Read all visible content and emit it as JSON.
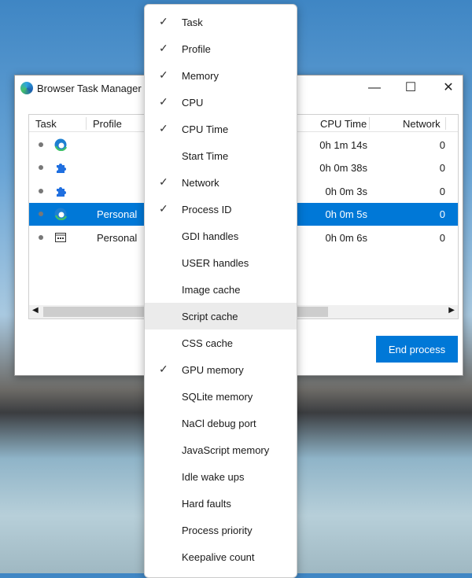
{
  "window": {
    "title": "Browser Task Manager",
    "minimize": "—",
    "maximize": "☐",
    "close": "✕"
  },
  "table": {
    "headers": {
      "task": "Task",
      "profile": "Profile",
      "cpu_time": "CPU Time",
      "network": "Network"
    },
    "rows": [
      {
        "icon": "edge-beta-icon",
        "profile": "",
        "cpu_time": "0h 1m 14s",
        "network": "0",
        "selected": false
      },
      {
        "icon": "extension-icon",
        "profile": "",
        "cpu_time": "0h 0m 38s",
        "network": "0",
        "selected": false
      },
      {
        "icon": "extension-icon",
        "profile": "",
        "cpu_time": "0h 0m 3s",
        "network": "0",
        "selected": false
      },
      {
        "icon": "edge-icon",
        "profile": "Personal",
        "cpu_time": "0h 0m 5s",
        "network": "0",
        "selected": true
      },
      {
        "icon": "utility-process-icon",
        "profile": "Personal",
        "cpu_time": "0h 0m 6s",
        "network": "0",
        "selected": false
      }
    ]
  },
  "end_process": "End process",
  "menu": {
    "check": "✓",
    "items": [
      {
        "label": "Task",
        "checked": true
      },
      {
        "label": "Profile",
        "checked": true
      },
      {
        "label": "Memory",
        "checked": true
      },
      {
        "label": "CPU",
        "checked": true
      },
      {
        "label": "CPU Time",
        "checked": true
      },
      {
        "label": "Start Time",
        "checked": false
      },
      {
        "label": "Network",
        "checked": true
      },
      {
        "label": "Process ID",
        "checked": true
      },
      {
        "label": "GDI handles",
        "checked": false
      },
      {
        "label": "USER handles",
        "checked": false
      },
      {
        "label": "Image cache",
        "checked": false
      },
      {
        "label": "Script cache",
        "checked": false,
        "hover": true
      },
      {
        "label": "CSS cache",
        "checked": false
      },
      {
        "label": "GPU memory",
        "checked": true
      },
      {
        "label": "SQLite memory",
        "checked": false
      },
      {
        "label": "NaCl debug port",
        "checked": false
      },
      {
        "label": "JavaScript memory",
        "checked": false
      },
      {
        "label": "Idle wake ups",
        "checked": false
      },
      {
        "label": "Hard faults",
        "checked": false
      },
      {
        "label": "Process priority",
        "checked": false
      },
      {
        "label": "Keepalive count",
        "checked": false
      }
    ]
  },
  "colors": {
    "accent": "#0078d7"
  }
}
